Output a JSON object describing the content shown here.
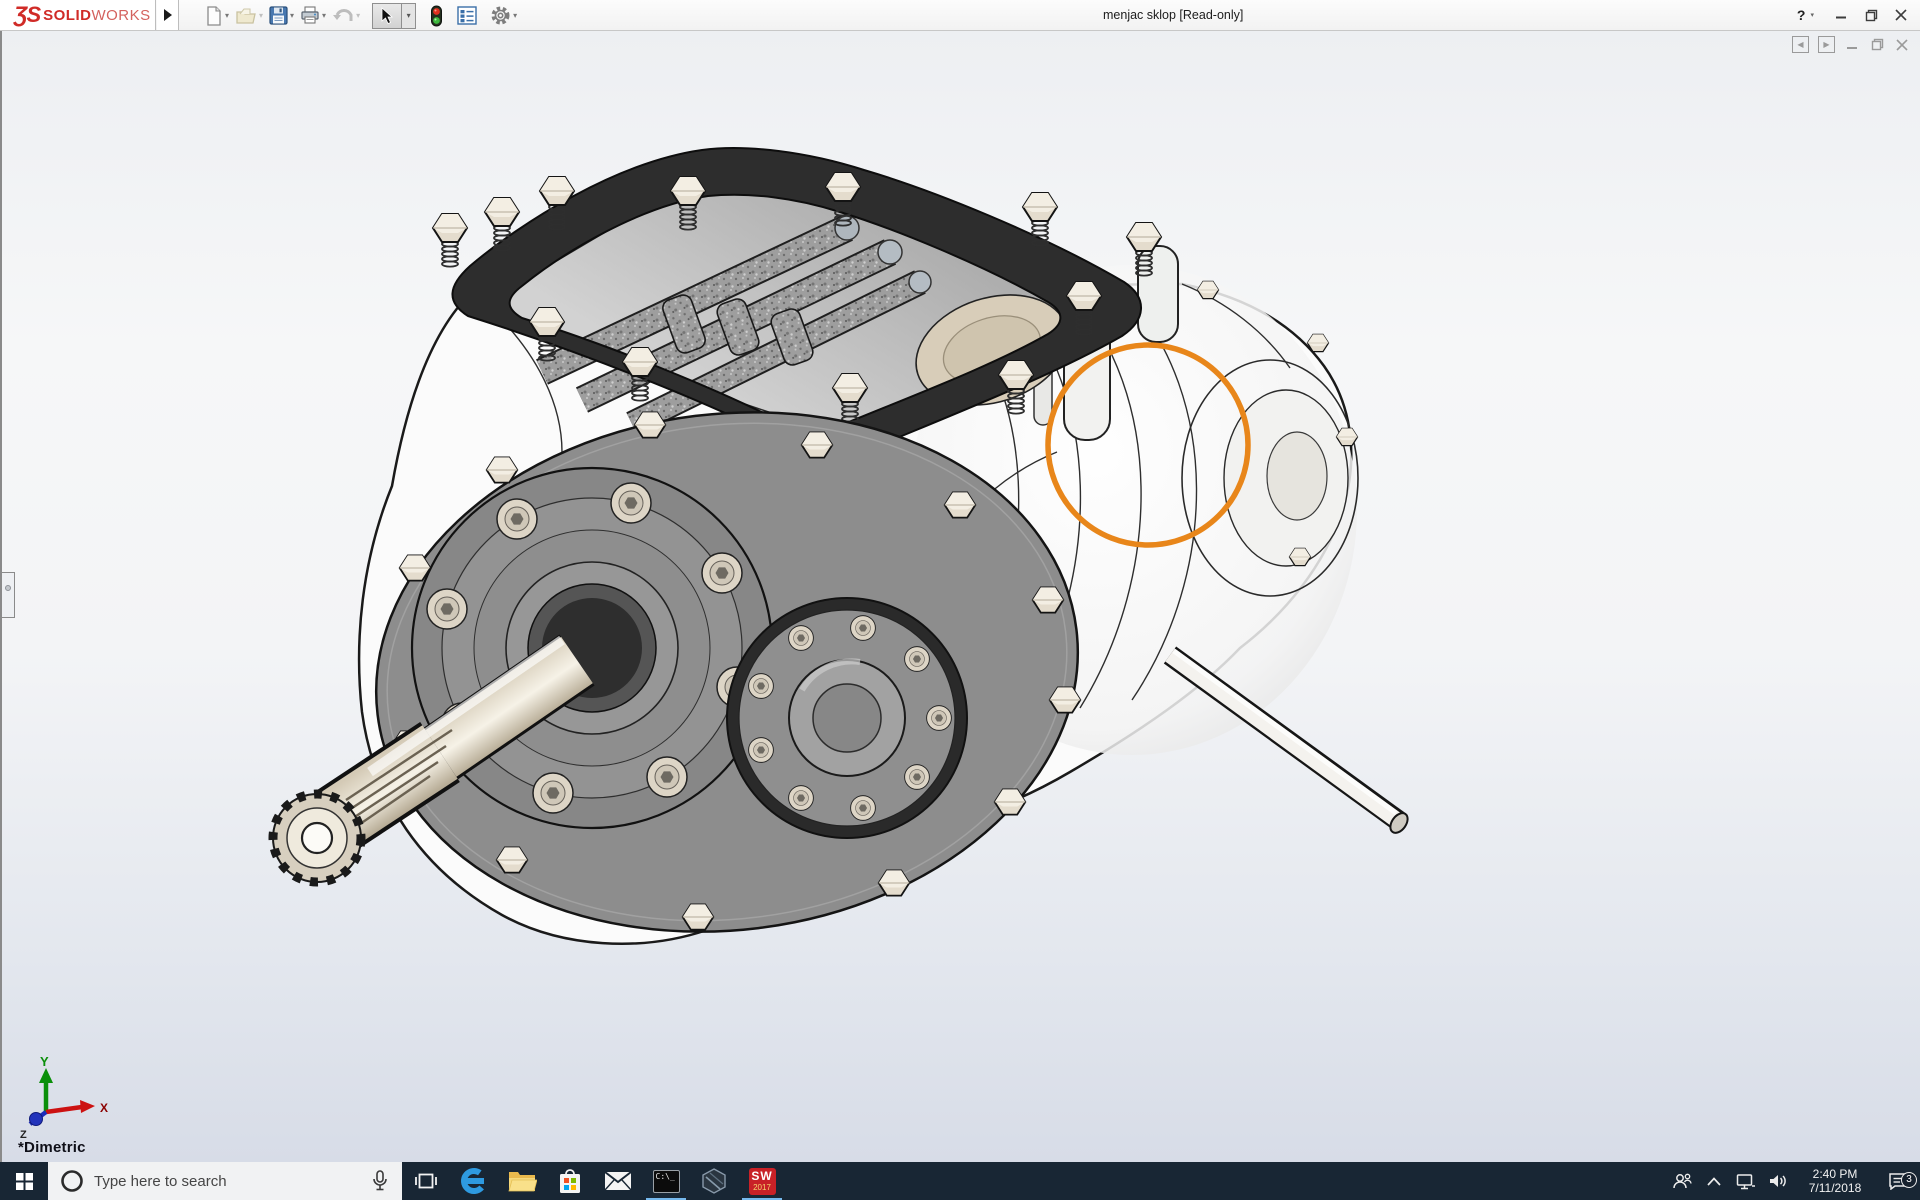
{
  "window": {
    "title": "menjac sklop [Read-only]",
    "help_glyph": "?"
  },
  "brand": {
    "logo_glyph": "ƷS",
    "name_bold": "SOLID",
    "name_light": "WORKS"
  },
  "toolbar": {
    "icons": [
      "new-document",
      "open-document",
      "save",
      "print",
      "undo",
      "select-tool",
      "view-traffic-light",
      "display-settings",
      "options-gear"
    ]
  },
  "viewport": {
    "orientation_label": "*Dimetric",
    "axis_labels": {
      "x": "X",
      "y": "Y",
      "z": "Z"
    },
    "annotation": {
      "type": "circle",
      "color": "#E8861A"
    }
  },
  "taskbar": {
    "search_placeholder": "Type here to search",
    "command_prompt_label": "C:\\_",
    "solidworks_badge": {
      "letters": "SW",
      "year": "2017"
    },
    "tray": {
      "time": "2:40 PM",
      "date": "7/11/2018",
      "notification_badge": "3"
    }
  }
}
